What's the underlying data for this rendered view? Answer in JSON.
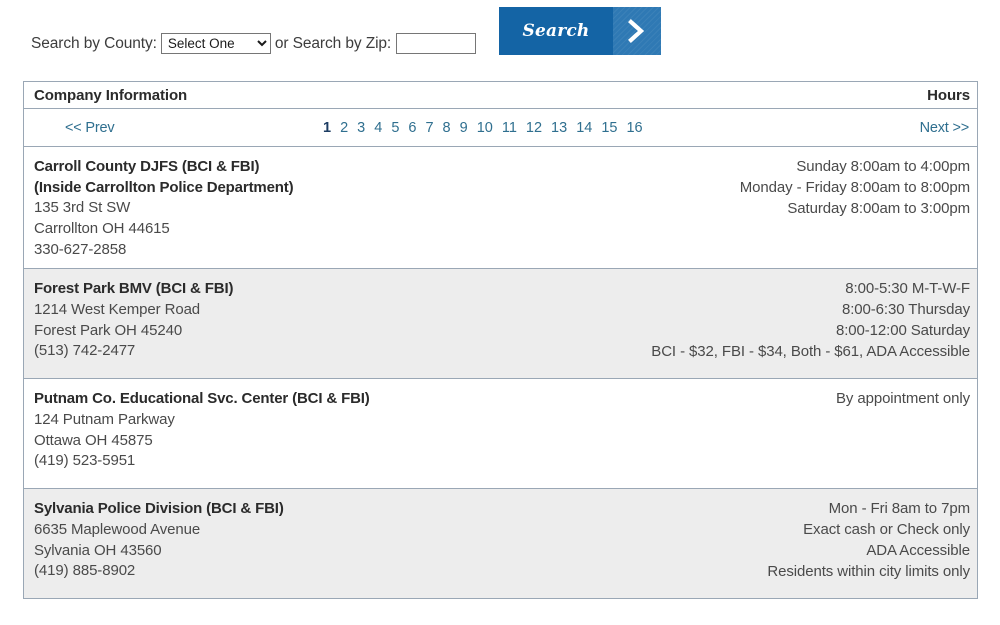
{
  "search": {
    "county_label": "Search by County:",
    "county_selected": "Select One",
    "county_options": [
      "Select One"
    ],
    "zip_label": "or Search by Zip:",
    "zip_value": "",
    "zip_placeholder": "",
    "button_label": "Search",
    "button_icon": "chevron-right-icon",
    "accent_color": "#1464a5",
    "accent_color_light": "#2f79b4"
  },
  "table": {
    "header": {
      "company": "Company Information",
      "hours": "Hours"
    },
    "pagination": {
      "prev_label": "<< Prev",
      "next_label": "Next >>",
      "current_page": 1,
      "pages": [
        "1",
        "2",
        "3",
        "4",
        "5",
        "6",
        "7",
        "8",
        "9",
        "10",
        "11",
        "12",
        "13",
        "14",
        "15",
        "16"
      ],
      "link_color": "#2f6f8f",
      "current_color": "#1d3d63"
    },
    "rows": [
      {
        "name_lines": [
          "Carroll County DJFS (BCI & FBI)",
          "(Inside Carrollton Police Department)"
        ],
        "address_lines": [
          "135 3rd St SW",
          "Carrollton OH 44615",
          "330-627-2858"
        ],
        "hours_lines": [
          "Sunday 8:00am to 4:00pm",
          "Monday - Friday 8:00am to 8:00pm",
          "Saturday 8:00am to 3:00pm"
        ]
      },
      {
        "name_lines": [
          "Forest Park BMV (BCI & FBI)"
        ],
        "address_lines": [
          "1214 West Kemper Road",
          "Forest Park OH 45240",
          "(513) 742-2477"
        ],
        "hours_lines": [
          "8:00-5:30 M-T-W-F",
          "8:00-6:30 Thursday",
          "8:00-12:00 Saturday",
          "BCI - $32, FBI - $34, Both - $61, ADA Accessible"
        ]
      },
      {
        "name_lines": [
          "Putnam Co. Educational Svc. Center (BCI & FBI)"
        ],
        "address_lines": [
          "124 Putnam Parkway",
          "Ottawa OH 45875",
          "(419) 523-5951"
        ],
        "hours_lines": [
          "By appointment only"
        ]
      },
      {
        "name_lines": [
          "Sylvania Police Division (BCI & FBI)"
        ],
        "address_lines": [
          "6635 Maplewood Avenue",
          "Sylvania OH 43560",
          "(419) 885-8902"
        ],
        "hours_lines": [
          "Mon - Fri 8am to 7pm",
          "Exact cash or Check only",
          "ADA Accessible",
          "Residents within city limits only"
        ]
      }
    ]
  }
}
